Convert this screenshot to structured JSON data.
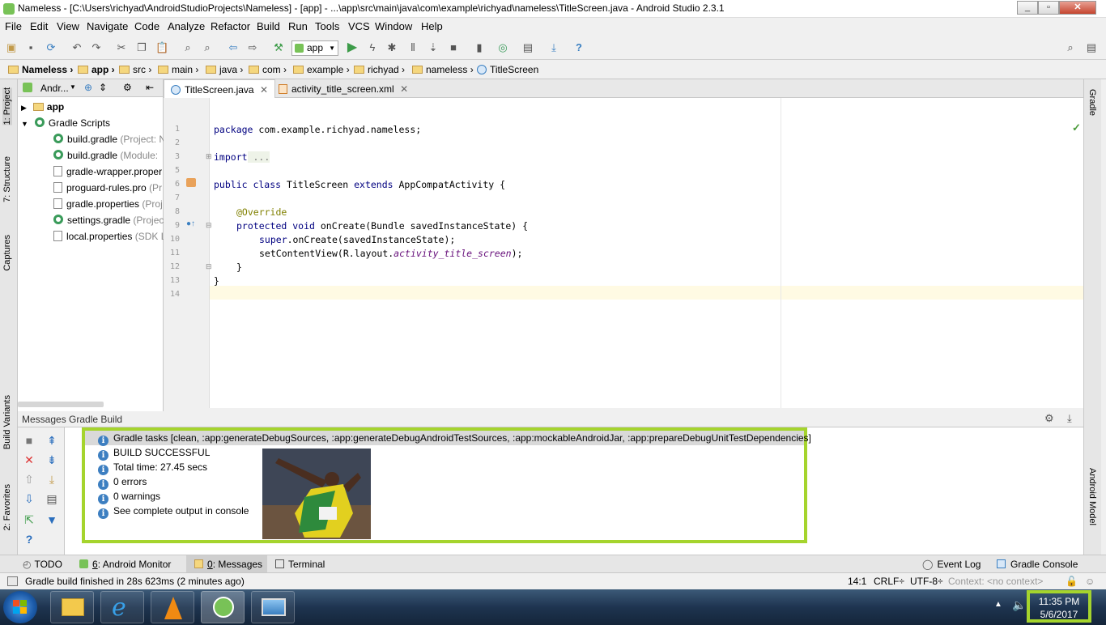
{
  "window": {
    "title": "Nameless - [C:\\Users\\richyad\\AndroidStudioProjects\\Nameless] - [app] - ...\\app\\src\\main\\java\\com\\example\\richyad\\nameless\\TitleScreen.java - Android Studio 2.3.1"
  },
  "menu": [
    "File",
    "Edit",
    "View",
    "Navigate",
    "Code",
    "Analyze",
    "Refactor",
    "Build",
    "Run",
    "Tools",
    "VCS",
    "Window",
    "Help"
  ],
  "toolbar": {
    "run_config": "app"
  },
  "breadcrumbs": [
    "Nameless",
    "app",
    "src",
    "main",
    "java",
    "com",
    "example",
    "richyad",
    "nameless",
    "TitleScreen"
  ],
  "left_tabs": {
    "project": "1: Project",
    "structure": "7: Structure",
    "captures": "Captures",
    "build_variants": "Build Variants",
    "favorites": "2: Favorites"
  },
  "right_tabs": {
    "gradle": "Gradle",
    "android_model": "Android Model"
  },
  "project_panel": {
    "view": "Andr...",
    "items": [
      {
        "name": "app",
        "hint": ""
      },
      {
        "name": "Gradle Scripts",
        "hint": ""
      },
      {
        "name": "build.gradle",
        "hint": "(Project: N"
      },
      {
        "name": "build.gradle",
        "hint": "(Module: "
      },
      {
        "name": "gradle-wrapper.proper",
        "hint": ""
      },
      {
        "name": "proguard-rules.pro",
        "hint": "(Pr"
      },
      {
        "name": "gradle.properties",
        "hint": "(Proj"
      },
      {
        "name": "settings.gradle",
        "hint": "(Project"
      },
      {
        "name": "local.properties",
        "hint": "(SDK L"
      }
    ]
  },
  "editor": {
    "tabs": [
      "TitleScreen.java",
      "activity_title_screen.xml"
    ],
    "line_numbers": [
      "1",
      "2",
      "3",
      "5",
      "6",
      "7",
      "8",
      "9",
      "10",
      "11",
      "12",
      "13",
      "14"
    ],
    "code": {
      "l1_kw": "package",
      "l1_rest": " com.example.richyad.nameless;",
      "l3_kw": "import",
      "l3_rest": " ...",
      "l6_kw1": "public class",
      "l6_mid": " TitleScreen ",
      "l6_kw2": "extends",
      "l6_rest": " AppCompatActivity {",
      "l8_ann": "@Override",
      "l9_kw1": "protected void",
      "l9_rest": " onCreate(Bundle savedInstanceState) {",
      "l10_kw": "super",
      "l10_rest": ".onCreate(savedInstanceState);",
      "l11_a": "setContentView(R.layout.",
      "l11_fld": "activity_title_screen",
      "l11_b": ");",
      "l12": "}",
      "l13": "}"
    }
  },
  "messages": {
    "header": "Messages Gradle Build",
    "lines": [
      "Gradle tasks [clean, :app:generateDebugSources, :app:generateDebugAndroidTestSources, :app:mockableAndroidJar, :app:prepareDebugUnitTestDependencies]",
      "BUILD SUCCESSFUL",
      "Total time: 27.45 secs",
      "0 errors",
      "0 warnings",
      "See complete output in console"
    ]
  },
  "bottom_tabs": {
    "todo": "TODO",
    "monitor_num": "6",
    "monitor": ": Android Monitor",
    "messages_num": "0",
    "messages": ": Messages",
    "terminal": "Terminal",
    "event_log": "Event Log",
    "gradle_console": "Gradle Console"
  },
  "status": {
    "text": "Gradle build finished in 28s 623ms (2 minutes ago)",
    "position": "14:1",
    "line_sep": "CRLF÷",
    "encoding": "UTF-8÷",
    "context": "Context: <no context>"
  },
  "clock": {
    "time": "11:35 PM",
    "date": "5/6/2017"
  }
}
